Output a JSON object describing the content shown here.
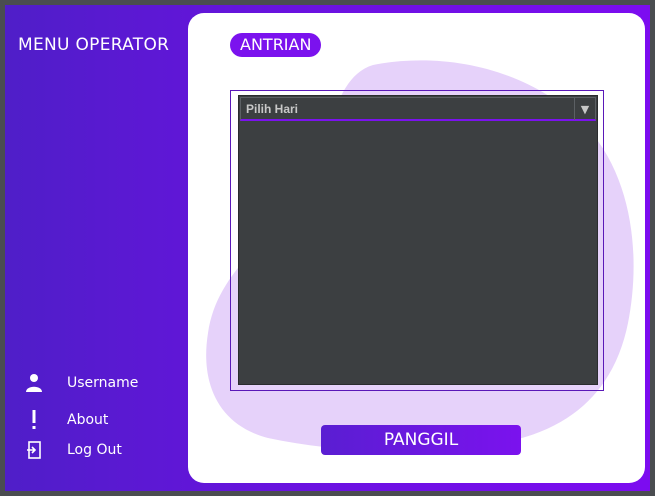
{
  "sidebar": {
    "title": "MENU OPERATOR",
    "items": [
      {
        "label": "Username",
        "icon": "user-icon"
      },
      {
        "label": "About",
        "icon": "exclamation-icon"
      },
      {
        "label": "Log Out",
        "icon": "logout-icon"
      }
    ]
  },
  "main": {
    "section_label": "ANTRIAN",
    "day_select": {
      "selected": "Pilih Hari"
    },
    "call_button_label": "PANGGIL"
  },
  "colors": {
    "accent": "#7b12ee",
    "sidebar_gradient_start": "#4f1ec8",
    "blob": "#e6d2fa",
    "table_bg": "#3c3f41"
  }
}
